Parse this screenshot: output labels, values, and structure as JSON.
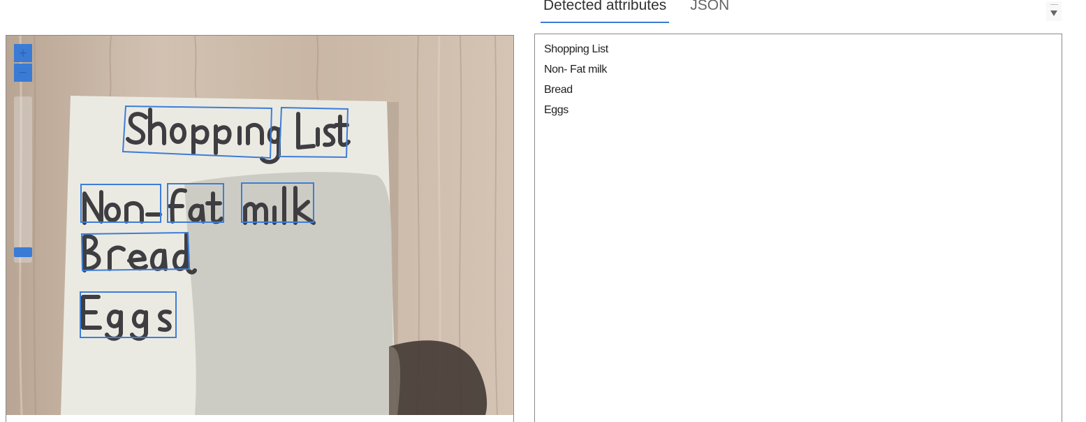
{
  "tabs": [
    {
      "label": "Detected attributes",
      "active": true
    },
    {
      "label": "JSON",
      "active": false
    }
  ],
  "viewer": {
    "zoom_in_label": "+",
    "zoom_out_label": "−",
    "image_words": [
      "Shopping",
      "List",
      "Non-",
      "Fat",
      "milk",
      "Bread",
      "Eggs"
    ]
  },
  "detected_lines": [
    "Shopping List",
    "Non- Fat milk",
    "Bread",
    "Eggs"
  ],
  "colors": {
    "accent": "#3a7bd5",
    "bounding_box": "#3c7dd9",
    "ink": "#3e3e42",
    "note_paper": "#ecebe3",
    "table_wood": "#cbb8a6"
  }
}
